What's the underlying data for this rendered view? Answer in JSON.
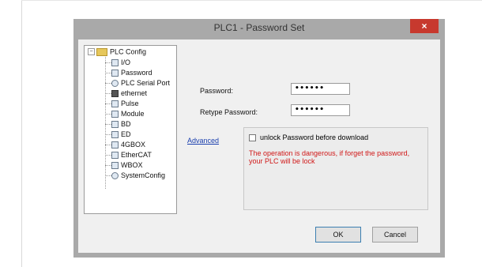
{
  "dialog": {
    "title": "PLC1 - Password  Set",
    "close_glyph": "×"
  },
  "tree": {
    "root": {
      "label": "PLC Config",
      "expander": "−"
    },
    "items": [
      {
        "label": "I/O",
        "icon": "io-icon"
      },
      {
        "label": "Password",
        "icon": "password-icon"
      },
      {
        "label": "PLC Serial Port",
        "icon": "serial-port-icon"
      },
      {
        "label": "ethernet",
        "icon": "ethernet-icon"
      },
      {
        "label": "Pulse",
        "icon": "pulse-icon"
      },
      {
        "label": "Module",
        "icon": "module-icon"
      },
      {
        "label": "BD",
        "icon": "bd-icon"
      },
      {
        "label": "ED",
        "icon": "ed-icon"
      },
      {
        "label": "4GBOX",
        "icon": "4gbox-icon"
      },
      {
        "label": "EtherCAT",
        "icon": "ethercat-icon"
      },
      {
        "label": "WBOX",
        "icon": "wbox-icon"
      },
      {
        "label": "SystemConfig",
        "icon": "system-config-icon"
      }
    ]
  },
  "form": {
    "password_label": "Password:",
    "password_value": "••••••",
    "retype_label": "Retype Password:",
    "retype_value": "••••••",
    "advanced_link": "Advanced",
    "unlock_label": "unlock Password before download",
    "unlock_checked": false,
    "warning": "The operation is dangerous, if forget the password, your PLC will be lock"
  },
  "buttons": {
    "ok": "OK",
    "cancel": "Cancel"
  },
  "colors": {
    "warning": "#d01818",
    "link": "#1a3fae",
    "close": "#c7392e"
  }
}
